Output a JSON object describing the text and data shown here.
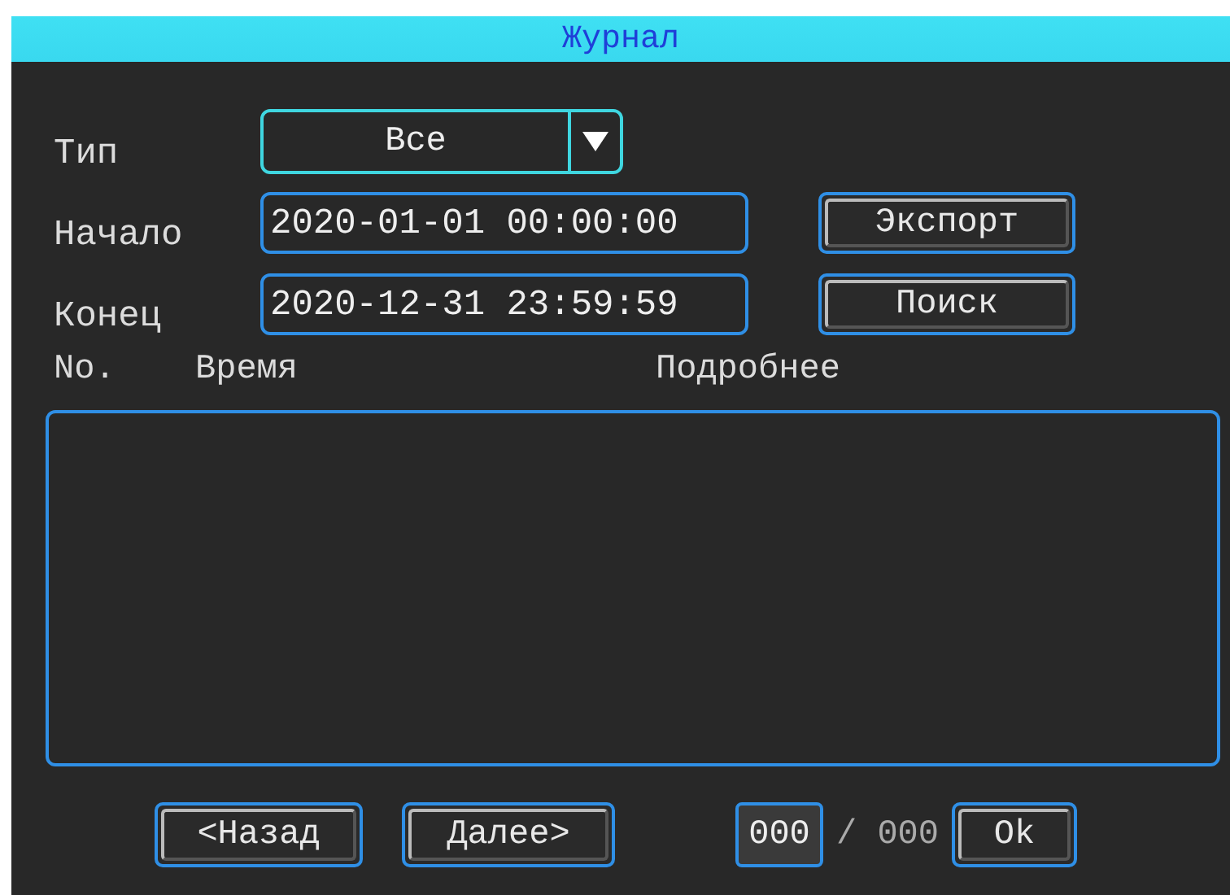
{
  "window": {
    "title": "Журнал"
  },
  "filters": [
    {
      "kind": "select",
      "label": "Тип",
      "value": "Все",
      "focused": true
    },
    {
      "kind": "datetime",
      "label": "Начало",
      "value": "2020-01-01 00:00:00",
      "focused": false,
      "button": "Экспорт"
    },
    {
      "kind": "datetime",
      "label": "Конец",
      "value": "2020-12-31 23:59:59",
      "focused": false,
      "button": "Поиск"
    }
  ],
  "list": {
    "columns": [
      "No.",
      "Время",
      "Подробнее"
    ]
  },
  "pager": {
    "prev": "<Назад",
    "next": "Далее>",
    "page": "000",
    "total": "/ 000",
    "ok": "Ok"
  }
}
